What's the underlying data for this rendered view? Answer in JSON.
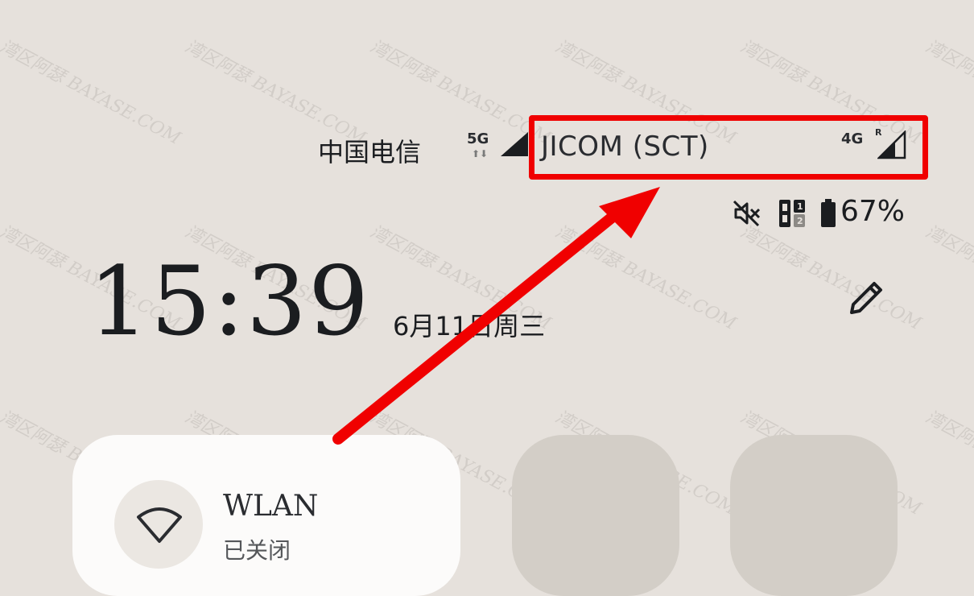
{
  "status_bar": {
    "carrier_1": "中国电信",
    "network_1": "5G",
    "network_1_arrows": "⬆⬇",
    "carrier_2": "JICOM (SCT)",
    "network_2": "4G",
    "network_2_roaming": "R",
    "battery_percent": "67%"
  },
  "clock": {
    "time": "15:39",
    "date": "6月11日周三"
  },
  "tiles": {
    "wlan": {
      "title": "WLAN",
      "subtitle": "已关闭"
    }
  },
  "watermark": {
    "text": "湾区阿瑟 BAYASE.COM"
  },
  "icons": {
    "signal": "signal-icon",
    "mute": "mute-icon",
    "dual_sim": "dual-sim-icon",
    "battery": "battery-icon",
    "edit": "pencil-icon",
    "wifi": "wifi-icon"
  },
  "colors": {
    "background": "#e6e1dc",
    "annotation_red": "#f00000",
    "tile_active": "#fcfbfa",
    "tile_inactive": "#d3cec7"
  }
}
